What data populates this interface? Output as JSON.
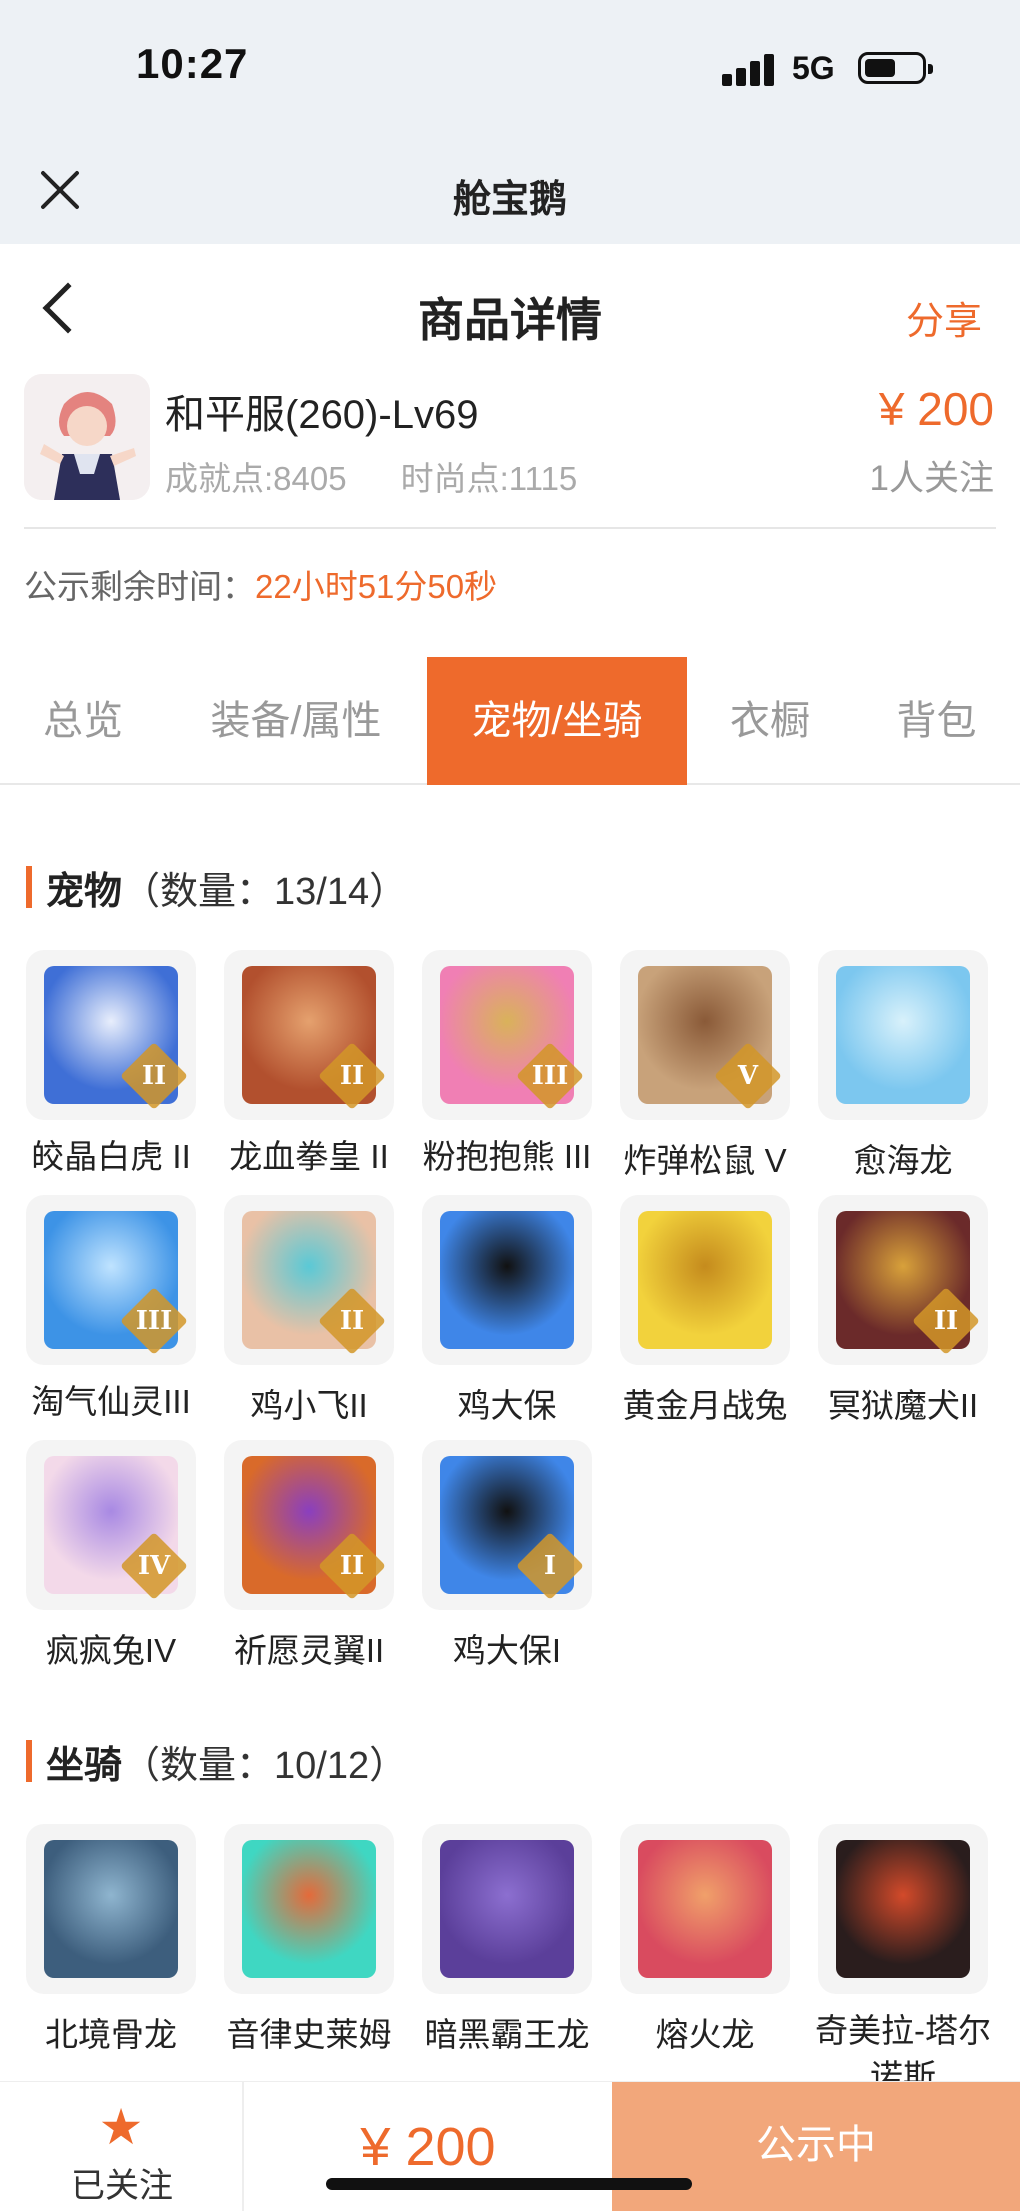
{
  "status_bar": {
    "time": "10:27",
    "network": "5G"
  },
  "app_bar": {
    "title": "舱宝鹅"
  },
  "header": {
    "title": "商品详情",
    "share_label": "分享"
  },
  "product": {
    "name": "和平服(260)-Lv69",
    "achievement": "成就点:8405",
    "fashion": "时尚点:1115",
    "price": "¥ 200",
    "followers": "1人关注"
  },
  "countdown": {
    "label": "公示剩余时间：",
    "value": "22小时51分50秒"
  },
  "tabs": [
    "总览",
    "装备/属性",
    "宠物/坐骑",
    "衣橱",
    "背包"
  ],
  "active_tab": 2,
  "pets": {
    "title": "宠物",
    "count": "（数量：13/14）",
    "items": [
      {
        "name": "皎晶白虎 II",
        "badge": "II",
        "color": "#3f6fd6",
        "accent": "#e8eefc"
      },
      {
        "name": "龙血拳皇 II",
        "badge": "II",
        "color": "#b2502e",
        "accent": "#e5a16e"
      },
      {
        "name": "粉抱抱熊 III",
        "badge": "III",
        "color": "#f07fb4",
        "accent": "#d9b25a"
      },
      {
        "name": "炸弹松鼠 V",
        "badge": "V",
        "color": "#c8a27a",
        "accent": "#8a5a38"
      },
      {
        "name": "愈海龙",
        "badge": "",
        "color": "#7cc7ef",
        "accent": "#d8f1fb"
      },
      {
        "name": "淘气仙灵III",
        "badge": "III",
        "color": "#3d93e6",
        "accent": "#bfe3ff"
      },
      {
        "name": "鸡小飞II",
        "badge": "II",
        "color": "#e9c1a6",
        "accent": "#5ac9d6"
      },
      {
        "name": "鸡大保",
        "badge": "",
        "color": "#3f86e8",
        "accent": "#111111"
      },
      {
        "name": "黄金月战兔",
        "badge": "",
        "color": "#f2d23c",
        "accent": "#c58b1d"
      },
      {
        "name": "冥狱魔犬II",
        "badge": "II",
        "color": "#6b2a2a",
        "accent": "#d8a13a"
      },
      {
        "name": "疯疯兔IV",
        "badge": "IV",
        "color": "#f3d9e9",
        "accent": "#a889e3"
      },
      {
        "name": "祈愿灵翼II",
        "badge": "II",
        "color": "#d96a2a",
        "accent": "#8a3fbf"
      },
      {
        "name": "鸡大保I",
        "badge": "I",
        "color": "#3f86e8",
        "accent": "#111111"
      }
    ]
  },
  "mounts": {
    "title": "坐骑",
    "count": "（数量：10/12）",
    "items": [
      {
        "name": "北境骨龙",
        "color": "#3d5e7d",
        "accent": "#8fb5cf"
      },
      {
        "name": "音律史莱姆",
        "color": "#3fd7c2",
        "accent": "#e46a3a"
      },
      {
        "name": "暗黑霸王龙",
        "color": "#5b3f9a",
        "accent": "#8c6fd0"
      },
      {
        "name": "熔火龙",
        "color": "#d94b5f",
        "accent": "#f0a06a"
      },
      {
        "name": "奇美拉-塔尔诺斯",
        "color": "#2a1d1d",
        "accent": "#d34a2a"
      }
    ]
  },
  "bottom_bar": {
    "follow_label": "已关注",
    "price": "¥ 200",
    "cta_label": "公示中"
  },
  "colors": {
    "accent": "#ee6a2c",
    "cta_disabled": "#f2a77b"
  }
}
